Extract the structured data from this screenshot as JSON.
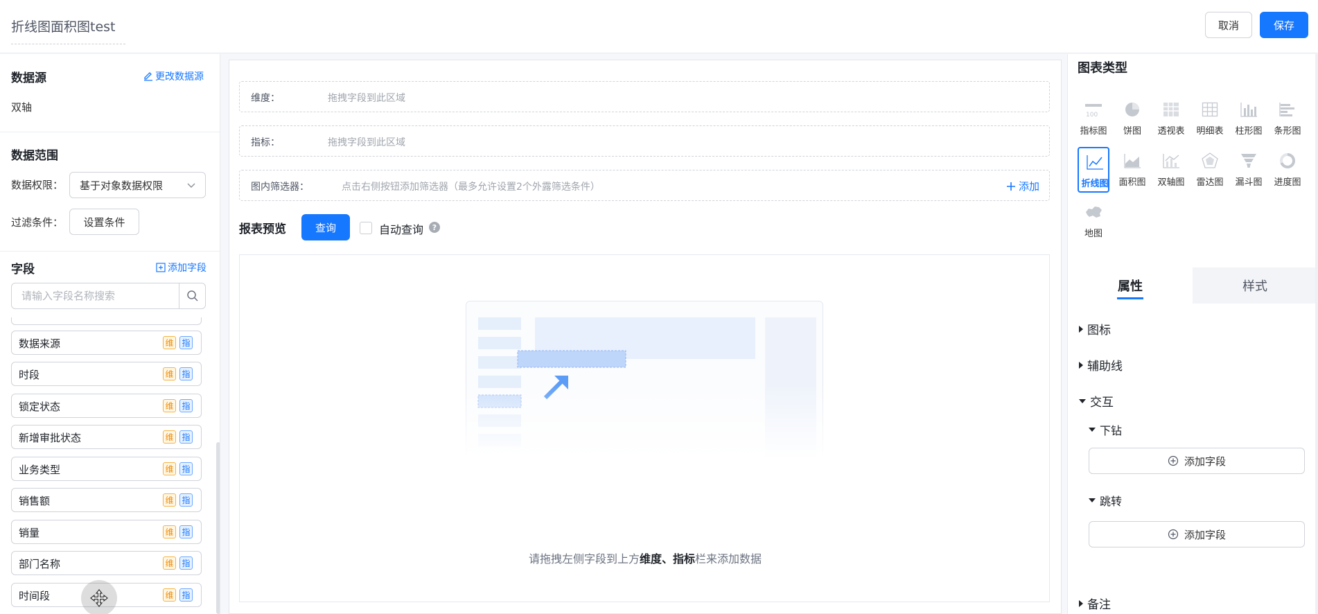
{
  "header": {
    "title": "折线图面积图test",
    "cancel_label": "取消",
    "save_label": "保存"
  },
  "left": {
    "datasource_title": "数据源",
    "change_datasource_label": "更改数据源",
    "datasource_value": "双轴",
    "range_title": "数据范围",
    "permission_label": "数据权限：",
    "permission_value": "基于对象数据权限",
    "filter_label": "过滤条件：",
    "filter_button": "设置条件",
    "fields_title": "字段",
    "add_field_label": "添加字段",
    "search_placeholder": "请输入字段名称搜索",
    "dim_tag": "维",
    "mea_tag": "指",
    "fields": [
      "数据来源",
      "时段",
      "锁定状态",
      "新增审批状态",
      "业务类型",
      "销售额",
      "销量",
      "部门名称",
      "时间段"
    ]
  },
  "center": {
    "dimension_label": "维度：",
    "dimension_placeholder": "拖拽字段到此区域",
    "measure_label": "指标：",
    "measure_placeholder": "拖拽字段到此区域",
    "filter_label": "图内筛选器：",
    "filter_placeholder": "点击右侧按钮添加筛选器（最多允许设置2个外露筛选条件）",
    "filter_add": "添加",
    "preview_title": "报表预览",
    "query_button": "查询",
    "auto_query_label": "自动查询",
    "empty_prefix": "请拖拽左侧字段到上方",
    "empty_strong": "维度、指标",
    "empty_suffix": "栏来添加数据"
  },
  "right": {
    "chart_types_title": "图表类型",
    "chart_types": [
      "指标图",
      "饼图",
      "透视表",
      "明细表",
      "柱形图",
      "条形图",
      "折线图",
      "面积图",
      "双轴图",
      "雷达图",
      "漏斗图",
      "进度图",
      "地图"
    ],
    "active_chart_type": "折线图",
    "tab_props": "属性",
    "tab_style": "样式",
    "sec_icon": "图标",
    "sec_guide": "辅助线",
    "sec_interact": "交互",
    "sub_drill": "下钻",
    "sub_jump": "跳转",
    "add_field": "添加字段",
    "sec_note": "备注"
  },
  "colors": {
    "primary": "#1677ff",
    "dim_tag": "#f08c00",
    "mea_tag": "#1677ff"
  }
}
